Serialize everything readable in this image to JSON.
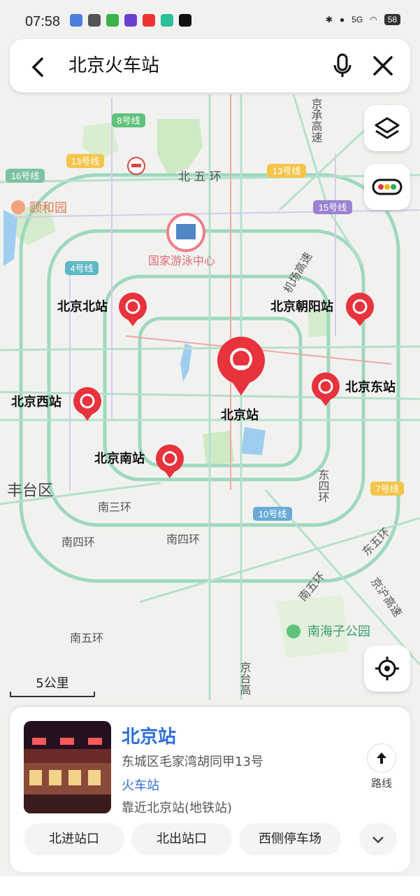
{
  "status_bar": {
    "time": "07:58",
    "battery": "58",
    "network": "5G"
  },
  "search": {
    "query": "北京火车站"
  },
  "map_labels": {
    "line8": "8号线",
    "line13a": "13号线",
    "line16": "16号线",
    "line13b": "13号线",
    "line15": "15号线",
    "line4": "4号线",
    "line10": "10号线",
    "line7": "7号线",
    "north5": "北 五 环",
    "summer_palace": "颐和园",
    "swim_center": "国家游泳中心",
    "airport_exp": "机场高速",
    "jingcheng": "京承高速",
    "fengtai": "丰台区",
    "south3": "南三环",
    "south4a": "南四环",
    "south4b": "南四环",
    "south5a": "南五环",
    "south5b": "南五环",
    "east4": "东四环",
    "east5": "东五环",
    "jinghu": "京沪高速",
    "jingtai": "京台高",
    "nanhaizi": "南海子公园"
  },
  "stations": {
    "main": "北京站",
    "north": "北京北站",
    "chaoyang": "北京朝阳站",
    "east": "北京东站",
    "west": "北京西站",
    "south": "北京南站"
  },
  "scale_label": "5公里",
  "place_card": {
    "name": "北京站",
    "address": "东城区毛家湾胡同甲13号",
    "category": "火车站",
    "nearby": "靠近北京站(地铁站)",
    "route_label": "路线",
    "chips": [
      "北进站口",
      "北出站口",
      "西侧停车场"
    ]
  },
  "colors": {
    "accent": "#2d6ed8",
    "pin": "#e8323c",
    "road": "#a9dcc6",
    "ring": "#8fd1b4"
  }
}
